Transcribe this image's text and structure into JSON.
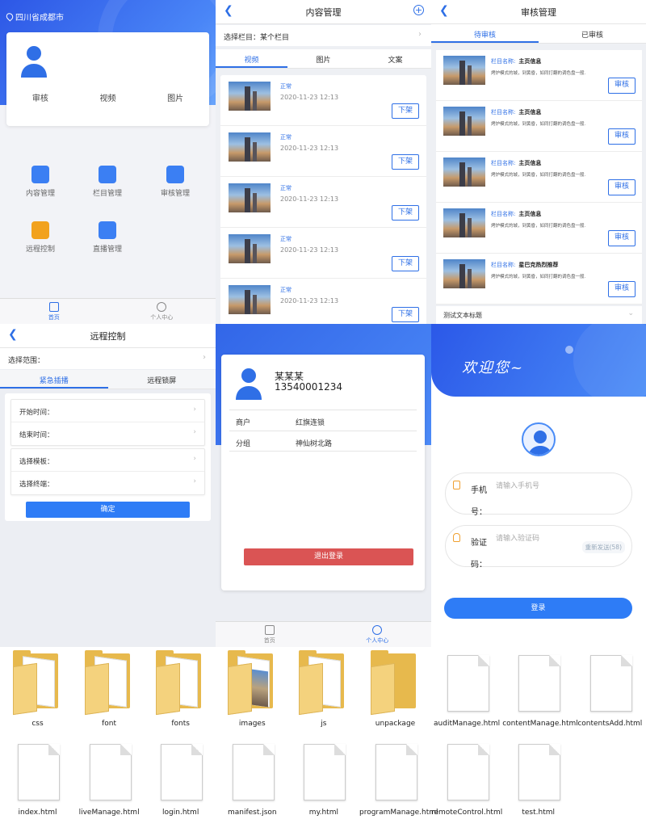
{
  "home": {
    "location": "四川省成都市",
    "tabs": [
      "审核",
      "视频",
      "图片"
    ],
    "menu": [
      {
        "label": "内容管理",
        "color": "#3b7ff3"
      },
      {
        "label": "栏目管理",
        "color": "#3b7ff3"
      },
      {
        "label": "审核管理",
        "color": "#3b7ff3"
      },
      {
        "label": "远程控制",
        "color": "#f2a21d"
      },
      {
        "label": "直播管理",
        "color": "#3b7ff3"
      }
    ],
    "tabbar": {
      "home": "首页",
      "me": "个人中心"
    }
  },
  "content": {
    "title": "内容管理",
    "select_label": "选择栏目：",
    "select_value": "某个栏目",
    "tabs": [
      "视频",
      "图片",
      "文案"
    ],
    "items": [
      {
        "status": "正常",
        "date": "2020-11-23 12:13",
        "btn": "下架"
      },
      {
        "status": "正常",
        "date": "2020-11-23 12:13",
        "btn": "下架"
      },
      {
        "status": "正常",
        "date": "2020-11-23 12:13",
        "btn": "下架"
      },
      {
        "status": "正常",
        "date": "2020-11-23 12:13",
        "btn": "下架"
      },
      {
        "status": "正常",
        "date": "2020-11-23 12:13",
        "btn": "下架"
      }
    ]
  },
  "audit": {
    "title": "审核管理",
    "tabs": [
      "待审核",
      "已审核"
    ],
    "items": [
      {
        "label": "栏目名称:",
        "name": "主页信息",
        "desc": "烤炉模式的城，到黄昏，如同打翻的调色盘一般.",
        "btn": "审核"
      },
      {
        "label": "栏目名称:",
        "name": "主页信息",
        "desc": "烤炉模式的城，到黄昏，如同打翻的调色盘一般.",
        "btn": "审核"
      },
      {
        "label": "栏目名称:",
        "name": "主页信息",
        "desc": "烤炉模式的城，到黄昏，如同打翻的调色盘一般.",
        "btn": "审核"
      },
      {
        "label": "栏目名称:",
        "name": "主页信息",
        "desc": "烤炉模式的城，到黄昏，如同打翻的调色盘一般.",
        "btn": "审核"
      },
      {
        "label": "栏目名称:",
        "name": "星巴克热烈推荐",
        "desc": "烤炉模式的城，到黄昏，如同打翻的调色盘一般.",
        "btn": "审核"
      }
    ],
    "footer": "测试文本标题"
  },
  "remote": {
    "title": "远程控制",
    "select_label": "选择范围：",
    "tabs": [
      "紧急插播",
      "远程锁屏"
    ],
    "rows1": [
      "开始时间：",
      "结束时间："
    ],
    "rows2": [
      "选择模板：",
      "选择终端："
    ],
    "confirm": "确定"
  },
  "my": {
    "name": "某某某",
    "phone": "13540001234",
    "rows": [
      {
        "k": "商户",
        "v": "红旗连锁"
      },
      {
        "k": "分组",
        "v": "神仙树北路"
      }
    ],
    "logout": "退出登录",
    "tabbar": {
      "home": "首页",
      "me": "个人中心"
    }
  },
  "login": {
    "welcome": "欢迎您~",
    "phone_label": "手机号：",
    "phone_ph": "请输入手机号",
    "code_label": "验证码：",
    "code_ph": "请输入验证码",
    "resend": "重新发送(58)",
    "submit": "登录"
  },
  "files": {
    "row1": [
      {
        "name": "css",
        "type": "folder"
      },
      {
        "name": "font",
        "type": "folder"
      },
      {
        "name": "fonts",
        "type": "folder"
      },
      {
        "name": "images",
        "type": "folder-img"
      },
      {
        "name": "js",
        "type": "folder"
      },
      {
        "name": "unpackage",
        "type": "folder-empty"
      },
      {
        "name": "auditManage.html",
        "type": "file"
      },
      {
        "name": "contentManage.html",
        "type": "file"
      },
      {
        "name": "contentsAdd.html",
        "type": "file"
      }
    ],
    "row2": [
      {
        "name": "index.html",
        "type": "file"
      },
      {
        "name": "liveManage.html",
        "type": "file"
      },
      {
        "name": "login.html",
        "type": "file"
      },
      {
        "name": "manifest.json",
        "type": "file"
      },
      {
        "name": "my.html",
        "type": "file"
      },
      {
        "name": "programManage.html",
        "type": "file"
      },
      {
        "name": "remoteControl.html",
        "type": "file"
      },
      {
        "name": "test.html",
        "type": "file"
      }
    ]
  }
}
